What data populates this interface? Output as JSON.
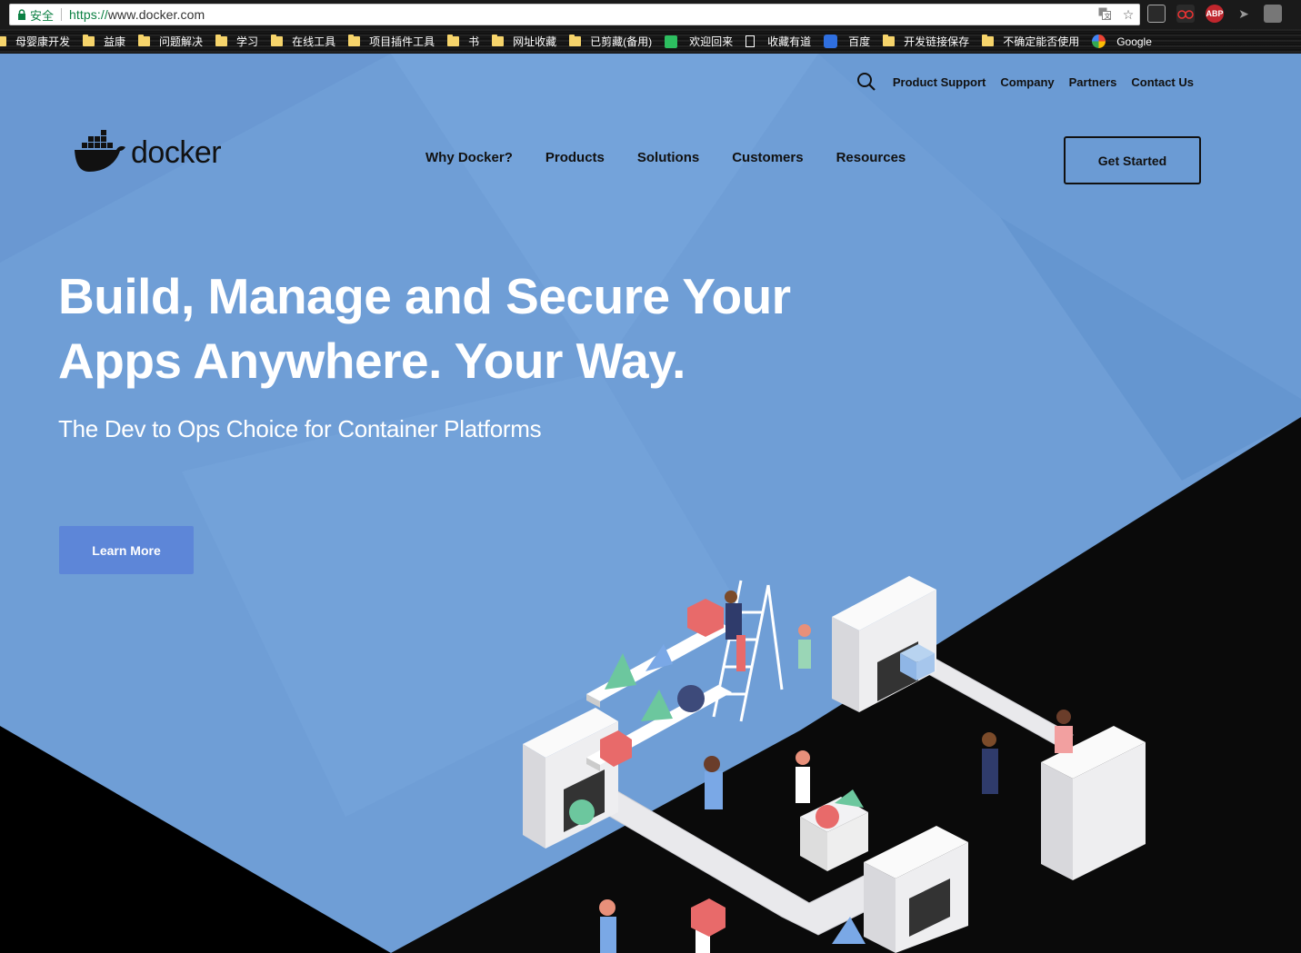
{
  "browser": {
    "secure_label": "安全",
    "url_scheme": "https://",
    "url_host": "www.docker.com",
    "bookmarks": [
      "母婴康开发",
      "益康",
      "问题解决",
      "学习",
      "在线工具",
      "项目插件工具",
      "书",
      "网址收藏",
      "已剪藏(备用)",
      "欢迎回来",
      "收藏有道",
      "百度",
      "开发链接保存",
      "不确定能否使用",
      "Google"
    ],
    "extensions": {
      "abp_label": "ABP"
    }
  },
  "site": {
    "logo_text": "docker",
    "utility_nav": [
      "Product Support",
      "Company",
      "Partners",
      "Contact Us"
    ],
    "main_nav": [
      "Why Docker?",
      "Products",
      "Solutions",
      "Customers",
      "Resources"
    ],
    "cta_label": "Get Started"
  },
  "hero": {
    "title_line1": "Build, Manage and Secure Your",
    "title_line2": "Apps Anywhere. Your Way.",
    "subtitle": "The Dev to Ops Choice for Container Platforms",
    "button_label": "Learn More"
  },
  "colors": {
    "hero_bg": "#6f9ed6",
    "button_bg": "#5d86d8",
    "dark": "#111111"
  }
}
